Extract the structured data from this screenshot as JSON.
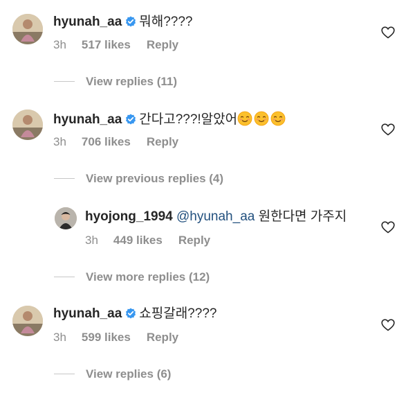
{
  "comments": [
    {
      "username": "hyunah_aa",
      "text": "뭐해????",
      "time": "3h",
      "likes": "517 likes",
      "reply": "Reply",
      "view_replies": "View replies (11)"
    },
    {
      "username": "hyunah_aa",
      "text": "간다고???!알았어",
      "emoji": [
        "smiling-face-icon",
        "smiling-face-icon",
        "smiling-face-icon"
      ],
      "time": "3h",
      "likes": "706 likes",
      "reply": "Reply",
      "view_replies": "View previous replies (4)"
    },
    {
      "username": "hyojong_1994",
      "mention": "@hyunah_aa",
      "text": "원한다면 가주지",
      "time": "3h",
      "likes": "449 likes",
      "reply": "Reply",
      "view_replies": "View more replies (12)"
    },
    {
      "username": "hyunah_aa",
      "text": "쇼핑갈래????",
      "time": "3h",
      "likes": "599 likes",
      "reply": "Reply",
      "view_replies": "View replies (6)"
    }
  ],
  "colors": {
    "text": "#262626",
    "secondary": "#8e8e8e",
    "mention": "#22507e",
    "verified": "#3897f0"
  }
}
